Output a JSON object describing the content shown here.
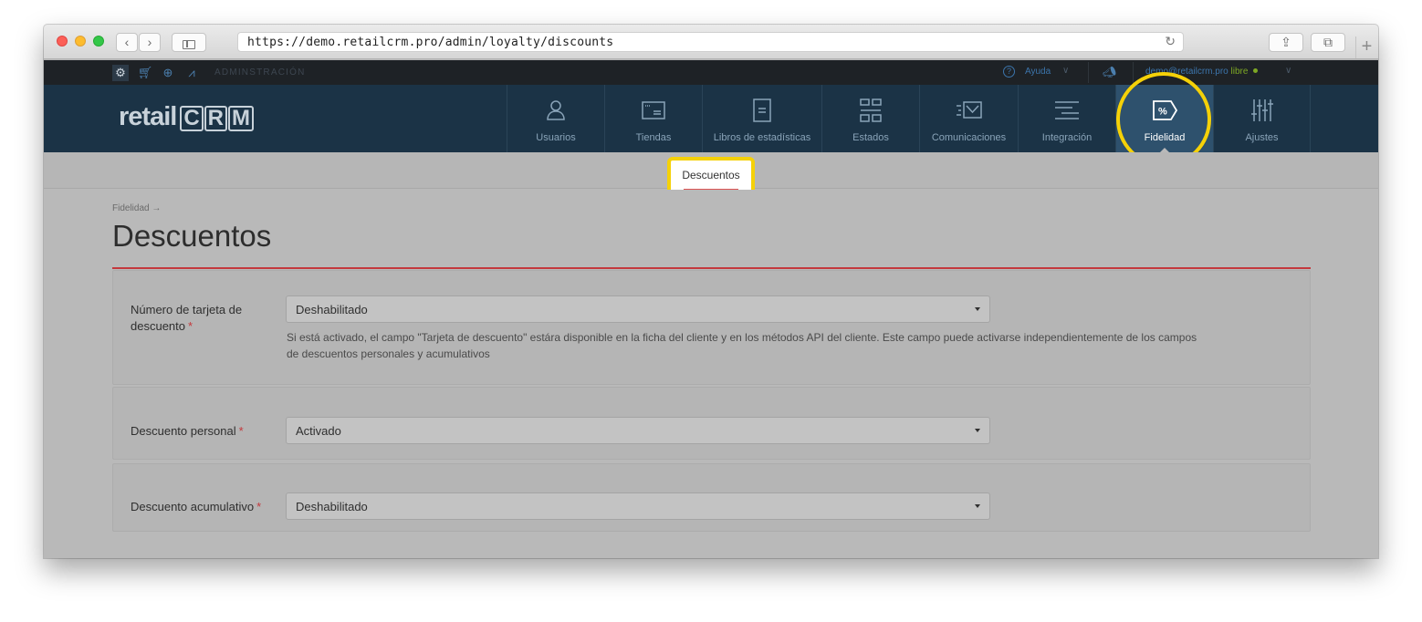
{
  "browser": {
    "url": "https://demo.retailcrm.pro/admin/loyalty/discounts",
    "back_icon": "‹",
    "forward_icon": "›",
    "reload_icon": "↻",
    "share_icon": "⇪",
    "tabs_icon": "⧉",
    "newtab_icon": "+"
  },
  "topbar": {
    "section": "ADMINSTRACIÓN",
    "help": "Ayuda",
    "user_email": "demo@retailcrm.pro",
    "user_plan": "libre",
    "icons": [
      "gear-icon",
      "cart-icon",
      "target-icon",
      "chart-icon"
    ]
  },
  "logo": {
    "text": "retail",
    "letters": [
      "C",
      "R",
      "M"
    ]
  },
  "main_nav": {
    "items": [
      {
        "label": "Usuarios",
        "icon": "user-icon"
      },
      {
        "label": "Tiendas",
        "icon": "store-icon"
      },
      {
        "label": "Libros de estadísticas",
        "icon": "book-icon"
      },
      {
        "label": "Estados",
        "icon": "statuses-icon"
      },
      {
        "label": "Comunicaciones",
        "icon": "communications-icon"
      },
      {
        "label": "Integración",
        "icon": "integration-icon"
      },
      {
        "label": "Fidelidad",
        "icon": "loyalty-tag-icon",
        "active": true
      },
      {
        "label": "Ajustes",
        "icon": "settings-sliders-icon"
      }
    ]
  },
  "sub_nav": {
    "active": "Descuentos"
  },
  "page": {
    "breadcrumb": "Fidelidad →",
    "title": "Descuentos"
  },
  "form": {
    "card_number": {
      "label": "Número de tarjeta de descuento",
      "value": "Deshabilitado",
      "help": "Si está activado, el campo \"Tarjeta de descuento\" estára disponible en la ficha del cliente y en los métodos API del cliente. Este campo puede activarse independientemente de los campos de descuentos personales y acumulativos"
    },
    "personal": {
      "label": "Descuento personal",
      "value": "Activado"
    },
    "cumulative": {
      "label": "Descuento acumulativo",
      "value": "Deshabilitado"
    },
    "required_mark": "*"
  },
  "colors": {
    "nav_bg": "#1b3346",
    "nav_active": "#2e516d",
    "highlight": "#f5d108",
    "accent_red": "#c4393d"
  }
}
